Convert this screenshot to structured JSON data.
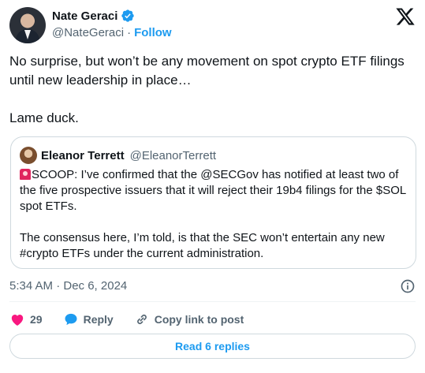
{
  "author": {
    "name": "Nate Geraci",
    "handle": "@NateGeraci",
    "separator": "·",
    "follow_label": "Follow"
  },
  "tweet": {
    "text": "No surprise, but won’t be any movement on spot crypto ETF filings until new leadership in place…\n\nLame duck.",
    "timestamp": "5:34 AM · Dec 6, 2024"
  },
  "quote": {
    "name": "Eleanor Terrett",
    "handle": "@EleanorTerrett",
    "text": "SCOOP: I’ve confirmed that the @SECGov has notified at least two of the five prospective issuers that it will reject their 19b4 filings for the $SOL spot ETFs.\n\nThe consensus here, I’m told, is that the SEC won’t entertain any new #crypto ETFs under the current administration."
  },
  "actions": {
    "like_count": "29",
    "reply_label": "Reply",
    "copy_link_label": "Copy link to post"
  },
  "read_replies_label": "Read 6 replies",
  "colors": {
    "accent": "#1d9bf0",
    "like": "#f91880",
    "text": "#0f1419",
    "muted": "#536471"
  },
  "icons": [
    "x-logo-icon",
    "verified-badge-icon",
    "info-icon",
    "heart-icon",
    "reply-bubble-icon",
    "link-icon",
    "siren-icon"
  ]
}
